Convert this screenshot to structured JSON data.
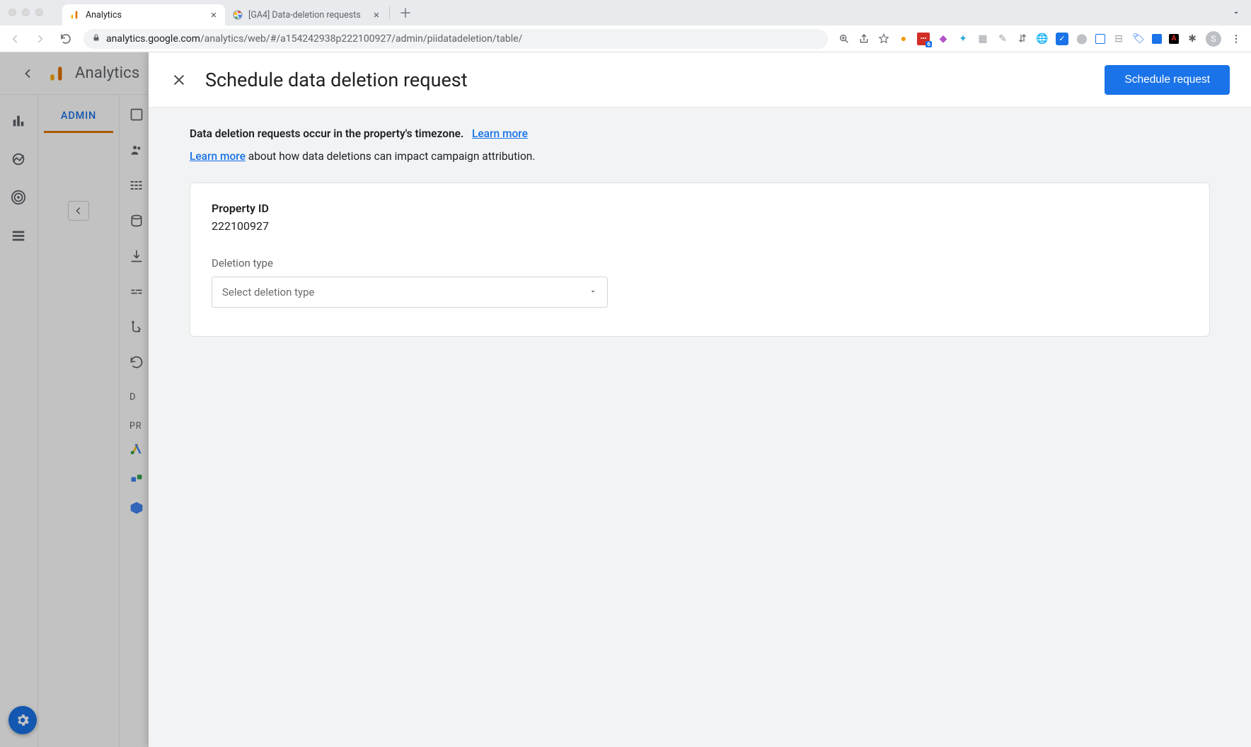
{
  "browser": {
    "tabs": [
      {
        "title": "Analytics",
        "active": true
      },
      {
        "title": "[GA4] Data-deletion requests",
        "active": false
      }
    ],
    "url_host": "analytics.google.com",
    "url_rest": "/analytics/web/#/a154242938p222100927/admin/piidatadeletion/table/",
    "extension_badge": "6",
    "profile_initial": "S"
  },
  "app": {
    "product_name": "Analytics",
    "admin_tab": "ADMIN",
    "data_display_section": "D",
    "product_links_section": "PR"
  },
  "modal": {
    "title": "Schedule data deletion request",
    "primary_button": "Schedule request",
    "info_text": "Data deletion requests occur in the property's timezone.",
    "info_link": "Learn more",
    "attribution_link": "Learn more",
    "attribution_rest": " about how data deletions can impact campaign attribution.",
    "property_id_label": "Property ID",
    "property_id_value": "222100927",
    "deletion_type_label": "Deletion type",
    "deletion_type_placeholder": "Select deletion type"
  }
}
